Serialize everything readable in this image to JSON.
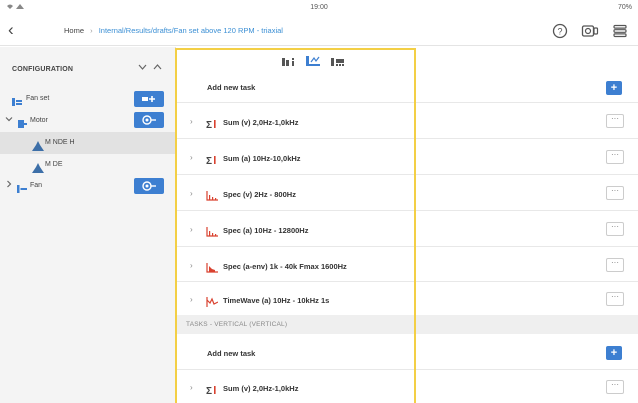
{
  "status": {
    "time": "19:00",
    "battery": "70%"
  },
  "nav": {
    "home": "Home",
    "separator": "›",
    "path": "Internal/Results/drafts/Fan set above 120 RPM - triaxial"
  },
  "config": {
    "title": "CONFIGURATION",
    "tree": [
      {
        "label": "Fan set"
      },
      {
        "label": "Motor"
      },
      {
        "label": "M NDE H"
      },
      {
        "label": "M DE"
      },
      {
        "label": "Fan"
      }
    ]
  },
  "tasks": {
    "add_label": "Add new task",
    "items": [
      {
        "label": "Sum (v) 2,0Hz-1,0kHz",
        "icon": "sum-icon"
      },
      {
        "label": "Sum (a) 10Hz-10,0kHz",
        "icon": "sum-icon"
      },
      {
        "label": "Spec (v) 2Hz - 800Hz",
        "icon": "spectrum-icon"
      },
      {
        "label": "Spec (a) 10Hz - 12800Hz",
        "icon": "spectrum-icon"
      },
      {
        "label": "Spec (a-env) 1k - 40k  Fmax 1600Hz",
        "icon": "envelope-spectrum-icon"
      },
      {
        "label": "TimeWave (a) 10Hz - 10kHz 1s",
        "icon": "timewave-icon"
      }
    ],
    "vertical_section": "TASKS - VERTICAL (VERTICAL)",
    "vertical_add_label": "Add new task",
    "vertical_items": [
      {
        "label": "Sum (v) 2,0Hz-1,0kHz",
        "icon": "sum-icon"
      }
    ]
  },
  "colors": {
    "accent": "#3d7fd1",
    "highlight": "#f3cf45",
    "red": "#d9412f"
  }
}
